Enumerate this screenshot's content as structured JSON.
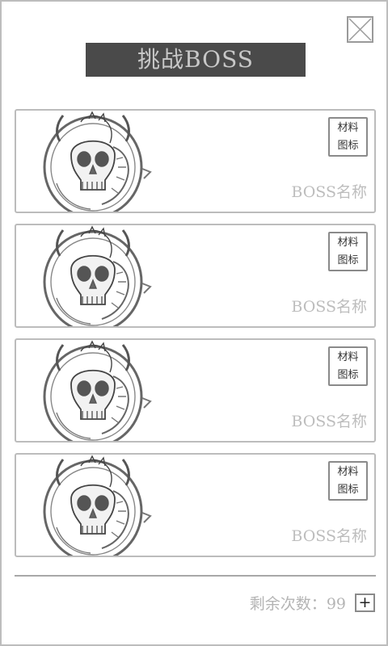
{
  "dialog": {
    "title": "挑战BOSS",
    "close_icon": "close-x-icon"
  },
  "bosses": [
    {
      "name": "BOSS名称",
      "material_line1": "材料",
      "material_line2": "图标",
      "portrait": "skull-dragon-emblem"
    },
    {
      "name": "BOSS名称",
      "material_line1": "材料",
      "material_line2": "图标",
      "portrait": "skull-dragon-emblem"
    },
    {
      "name": "BOSS名称",
      "material_line1": "材料",
      "material_line2": "图标",
      "portrait": "skull-dragon-emblem"
    },
    {
      "name": "BOSS名称",
      "material_line1": "材料",
      "material_line2": "图标",
      "portrait": "skull-dragon-emblem"
    }
  ],
  "footer": {
    "remaining_label": "剩余次数：",
    "remaining_count": "99",
    "add_label": "+"
  },
  "colors": {
    "title_bg": "#4a4a4a",
    "title_text": "#c8c8c8",
    "card_border": "#bcbcbc",
    "muted_text": "#bdbdbd"
  }
}
